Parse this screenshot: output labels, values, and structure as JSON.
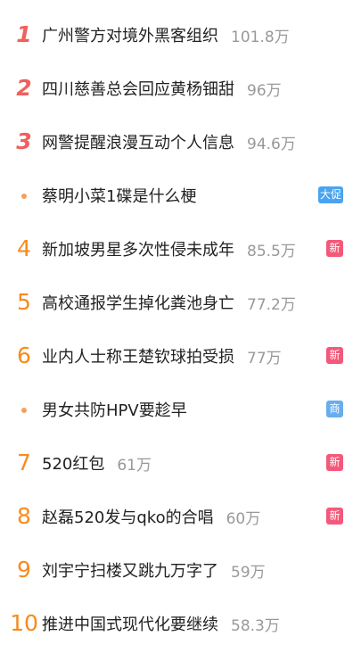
{
  "items": [
    {
      "rank": "1",
      "rank_style": "top",
      "title": "广州警方对境外黑客组织",
      "count": "101.8万",
      "badge": ""
    },
    {
      "rank": "2",
      "rank_style": "top",
      "title": "四川慈善总会回应黄杨钿甜",
      "count": "96万",
      "badge": ""
    },
    {
      "rank": "3",
      "rank_style": "top",
      "title": "网警提醒浪漫互动个人信息",
      "count": "94.6万",
      "badge": ""
    },
    {
      "rank": "",
      "rank_style": "dot",
      "title": "蔡明小菜1碟是什么梗",
      "count": "",
      "badge": "大促",
      "badge_color": "#4aa3f0"
    },
    {
      "rank": "4",
      "rank_style": "normal",
      "title": "新加坡男星多次性侵未成年",
      "count": "85.5万",
      "badge": "新",
      "badge_color": "#f5587a"
    },
    {
      "rank": "5",
      "rank_style": "normal",
      "title": "高校通报学生掉化粪池身亡",
      "count": "77.2万",
      "badge": ""
    },
    {
      "rank": "6",
      "rank_style": "normal",
      "title": "业内人士称王楚钦球拍受损",
      "count": "77万",
      "badge": "新",
      "badge_color": "#f5587a"
    },
    {
      "rank": "",
      "rank_style": "dot",
      "title": "男女共防HPV要趁早",
      "count": "",
      "badge": "商",
      "badge_color": "#67aef0"
    },
    {
      "rank": "7",
      "rank_style": "normal",
      "title": "520红包",
      "count": "61万",
      "badge": "新",
      "badge_color": "#f5587a"
    },
    {
      "rank": "8",
      "rank_style": "normal",
      "title": "赵磊520发与qko的合唱",
      "count": "60万",
      "badge": "新",
      "badge_color": "#f5587a"
    },
    {
      "rank": "9",
      "rank_style": "normal",
      "title": "刘宇宁扫楼又跳九万字了",
      "count": "59万",
      "badge": ""
    },
    {
      "rank": "10",
      "rank_style": "normal",
      "title": "推进中国式现代化要继续",
      "count": "58.3万",
      "badge": ""
    }
  ]
}
